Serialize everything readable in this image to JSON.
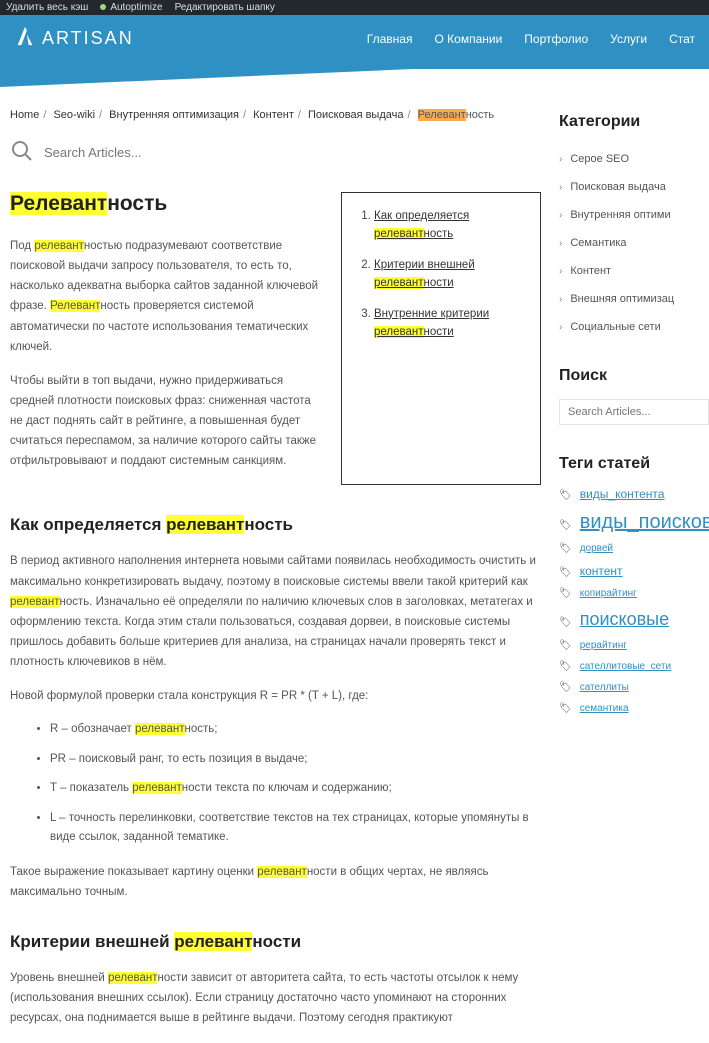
{
  "adminBar": {
    "clearCache": "Удалить весь кэш",
    "autoptimize": "Autoptimize",
    "editHeader": "Редактировать шапку"
  },
  "brand": "ARTISAN",
  "nav": {
    "home": "Главная",
    "about": "О Компании",
    "portfolio": "Портфолио",
    "services": "Услуги",
    "articles": "Стат"
  },
  "breadcrumb": {
    "home": "Home",
    "seowiki": "Seo-wiki",
    "internal": "Внутренняя оптимизация",
    "content": "Контент",
    "serp": "Поисковая выдача",
    "current_hl": "Релевант",
    "current_rest": "ность"
  },
  "search": {
    "placeholder": "Search Articles..."
  },
  "title": {
    "hl": "Релевант",
    "rest": "ность"
  },
  "intro": {
    "p1_a": "Под ",
    "p1_hl": "релевант",
    "p1_b": "ностью подразумевают соответствие поисковой выдачи запросу пользователя, то есть то, насколько адекватна выборка сайтов заданной ключевой фразе. ",
    "p1_hl2": "Релевант",
    "p1_c": "ность проверяется системой автоматически по частоте использования тематических ключей.",
    "p2": "Чтобы выйти в топ выдачи, нужно придерживаться средней плотности поисковых фраз: сниженная частота не даст поднять сайт в рейтинге, а повышенная будет считаться переспамом, за наличие которого сайты также отфильтровывают и поддают системным санкциям."
  },
  "toc": {
    "i1_a": "Как определяется ",
    "i1_hl": "релевант",
    "i1_b": "ность",
    "i2_a": "Критерии внешней ",
    "i2_hl": "релевант",
    "i2_b": "ности",
    "i3_a": "Внутренние критерии ",
    "i3_hl": "релевант",
    "i3_b": "ности"
  },
  "h2a": {
    "a": "Как определяется ",
    "hl": "релевант",
    "b": "ность"
  },
  "sec1": {
    "p1_a": "В период активного наполнения интернета новыми сайтами появилась необходимость очистить и максимально конкретизировать выдачу, поэтому в поисковые системы ввели такой критерий как ",
    "p1_hl": "релевант",
    "p1_b": "ность. Изначально её определяли по наличию ключевых слов в заголовках, метатегах и оформлению текста. Когда этим стали пользоваться, создавая дорвеи, в поисковые системы пришлось добавить больше критериев для анализа, на страницах начали проверять текст и плотность ключевиков в нём.",
    "p2": "Новой формулой проверки стала конструкция R = PR * (T + L), где:",
    "li1_a": "R – обозначает ",
    "li1_hl": "релевант",
    "li1_b": "ность;",
    "li2": "PR – поисковый ранг, то есть позиция в выдаче;",
    "li3_a": "T – показатель ",
    "li3_hl": "релевант",
    "li3_b": "ности текста по ключам и содержанию;",
    "li4": "L – точность перелинковки, соответствие текстов на тех страницах, которые упомянуты в виде ссылок, заданной тематике.",
    "p3_a": "Такое выражение показывает картину оценки ",
    "p3_hl": "релевант",
    "p3_b": "ности в общих чертах, не являясь максимально точным."
  },
  "h2b": {
    "a": "Критерии внешней ",
    "hl": "релевант",
    "b": "ности"
  },
  "sec2": {
    "p1_a": "Уровень внешней ",
    "p1_hl": "релевант",
    "p1_b": "ности зависит от авторитета сайта, то есть частоты отсылок к нему (использования внешних ссылок). Если страницу достаточно часто упоминают на сторонних ресурсах, она поднимается выше в рейтинге выдачи. Поэтому сегодня практикуют"
  },
  "sidebar": {
    "catsTitle": "Категории",
    "cats": [
      "Серое SEO",
      "Поисковая выдача",
      "Внутренняя оптими",
      "Семантика",
      "Контент",
      "Внешняя оптимизац",
      "Социальные сети"
    ],
    "searchTitle": "Поиск",
    "searchPlaceholder": "Search Articles...",
    "tagsTitle": "Теги статей",
    "tags": [
      {
        "t": "виды_контента",
        "s": "md"
      },
      {
        "t": "виды_поисковых запросов",
        "s": "lg"
      },
      {
        "t": "дорвей",
        "s": "sm"
      },
      {
        "t": "контент",
        "s": "md"
      },
      {
        "t": "копирайтинг",
        "s": "sm"
      },
      {
        "t": "поисковые",
        "s": "lg2"
      },
      {
        "t": "рерайтинг",
        "s": "sm"
      },
      {
        "t": "сателлитовые_сети",
        "s": "sm"
      },
      {
        "t": "сателлиты",
        "s": "sm"
      },
      {
        "t": "семантика",
        "s": "sm"
      }
    ]
  }
}
